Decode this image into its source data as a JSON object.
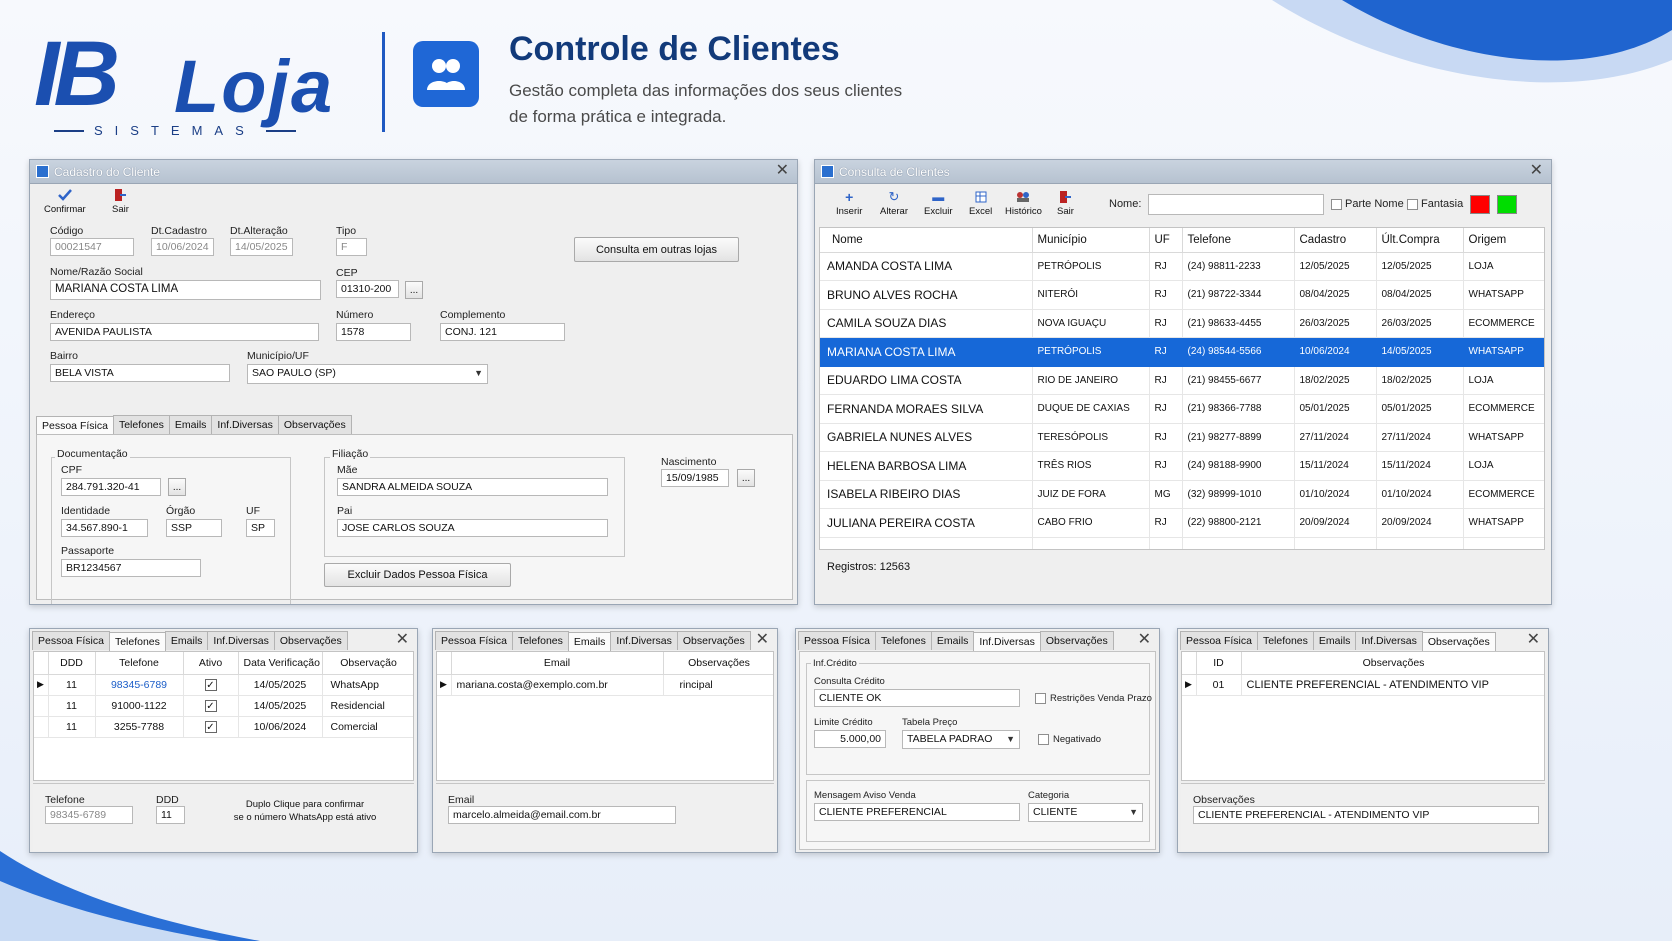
{
  "header": {
    "brand_ib": "IB",
    "brand_loja": "Loja",
    "brand_sistemas": "SISTEMAS",
    "title": "Controle de Clientes",
    "subtitle_line1": "Gestão completa das informações dos seus clientes",
    "subtitle_line2": "de forma prática e integrada."
  },
  "cadastro": {
    "title": "Cadastro do Cliente",
    "toolbar": {
      "confirmar": "Confirmar",
      "sair": "Sair"
    },
    "labels": {
      "codigo": "Código",
      "dt_cadastro": "Dt.Cadastro",
      "dt_alteracao": "Dt.Alteração",
      "tipo": "Tipo",
      "nome": "Nome/Razão Social",
      "cep": "CEP",
      "endereco": "Endereço",
      "numero": "Número",
      "complemento": "Complemento",
      "bairro": "Bairro",
      "municipio": "Município/UF"
    },
    "values": {
      "codigo": "00021547",
      "dt_cadastro": "10/06/2024",
      "dt_alteracao": "14/05/2025",
      "tipo": "F",
      "nome": "MARIANA COSTA LIMA",
      "cep": "01310-200",
      "endereco": "AVENIDA PAULISTA",
      "numero": "1578",
      "complemento": "CONJ. 121",
      "bairro": "BELA VISTA",
      "municipio": "SAO PAULO (SP)"
    },
    "btn_consulta_lojas": "Consulta em outras lojas",
    "ellipsis": "...",
    "tabs": [
      "Pessoa Física",
      "Telefones",
      "Emails",
      "Inf.Diversas",
      "Observações"
    ],
    "pf": {
      "documentacao": "Documentação",
      "cpf_label": "CPF",
      "cpf": "284.791.320-41",
      "identidade_label": "Identidade",
      "identidade": "34.567.890-1",
      "orgao_label": "Órgão",
      "orgao": "SSP",
      "uf_label": "UF",
      "uf": "SP",
      "passaporte_label": "Passaporte",
      "passaporte": "BR1234567",
      "filiacao": "Filiação",
      "mae_label": "Mãe",
      "mae": "SANDRA ALMEIDA SOUZA",
      "pai_label": "Pai",
      "pai": "JOSE CARLOS SOUZA",
      "nascimento_label": "Nascimento",
      "nascimento": "15/09/1985",
      "btn_excluir": "Excluir Dados Pessoa Física"
    }
  },
  "consulta": {
    "title": "Consulta de Clientes",
    "toolbar": [
      "Inserir",
      "Alterar",
      "Excluir",
      "Excel",
      "Histórico",
      "Sair"
    ],
    "nome_label": "Nome:",
    "nome_value": "",
    "parte_nome": "Parte Nome",
    "fantasia": "Fantasia",
    "colors": {
      "red": "#ff0000",
      "green": "#00dd00",
      "selection": "#1668d8"
    },
    "columns": [
      "Nome",
      "Município",
      "UF",
      "Telefone",
      "Cadastro",
      "Últ.Compra",
      "Origem"
    ],
    "rows": [
      [
        "AMANDA COSTA LIMA",
        "PETRÓPOLIS",
        "RJ",
        "(24) 98811-2233",
        "12/05/2025",
        "12/05/2025",
        "LOJA"
      ],
      [
        "BRUNO ALVES ROCHA",
        "NITERÓI",
        "RJ",
        "(21) 98722-3344",
        "08/04/2025",
        "08/04/2025",
        "WHATSAPP"
      ],
      [
        "CAMILA SOUZA DIAS",
        "NOVA IGUAÇU",
        "RJ",
        "(21) 98633-4455",
        "26/03/2025",
        "26/03/2025",
        "ECOMMERCE"
      ],
      [
        "MARIANA COSTA LIMA",
        "PETRÓPOLIS",
        "RJ",
        "(24) 98544-5566",
        "10/06/2024",
        "14/05/2025",
        "WHATSAPP"
      ],
      [
        "EDUARDO LIMA COSTA",
        "RIO DE JANEIRO",
        "RJ",
        "(21) 98455-6677",
        "18/02/2025",
        "18/02/2025",
        "LOJA"
      ],
      [
        "FERNANDA MORAES SILVA",
        "DUQUE DE CAXIAS",
        "RJ",
        "(21) 98366-7788",
        "05/01/2025",
        "05/01/2025",
        "ECOMMERCE"
      ],
      [
        "GABRIELA NUNES ALVES",
        "TERESÓPOLIS",
        "RJ",
        "(21) 98277-8899",
        "27/11/2024",
        "27/11/2024",
        "WHATSAPP"
      ],
      [
        "HELENA BARBOSA LIMA",
        "TRÊS RIOS",
        "RJ",
        "(24) 98188-9900",
        "15/11/2024",
        "15/11/2024",
        "LOJA"
      ],
      [
        "ISABELA RIBEIRO DIAS",
        "JUIZ DE FORA",
        "MG",
        "(32) 98999-1010",
        "01/10/2024",
        "01/10/2024",
        "ECOMMERCE"
      ],
      [
        "JULIANA PEREIRA COSTA",
        "CABO FRIO",
        "RJ",
        "(22) 98800-2121",
        "20/09/2024",
        "20/09/2024",
        "WHATSAPP"
      ]
    ],
    "selected_row": 3,
    "registros": "Registros: 12563"
  },
  "mini_tabs": [
    "Pessoa Física",
    "Telefones",
    "Emails",
    "Inf.Diversas",
    "Observações"
  ],
  "telefones": {
    "columns": [
      "DDD",
      "Telefone",
      "Ativo",
      "Data Verificação",
      "Observação"
    ],
    "rows": [
      [
        "11",
        "98345-6789",
        "✓",
        "14/05/2025",
        "WhatsApp"
      ],
      [
        "11",
        "91000-1122",
        "✓",
        "14/05/2025",
        "Residencial"
      ],
      [
        "11",
        "3255-7788",
        "✓",
        "10/06/2024",
        "Comercial"
      ]
    ],
    "telefone_label": "Telefone",
    "telefone": "98345-6789",
    "ddd_label": "DDD",
    "ddd": "11",
    "hint_line1": "Duplo Clique para confirmar",
    "hint_line2": "se o número WhatsApp está ativo"
  },
  "emails": {
    "columns": [
      "Email",
      "Observações"
    ],
    "rows": [
      [
        "mariana.costa@exemplo.com.br",
        "rincipal"
      ]
    ],
    "email_label": "Email",
    "email": "marcelo.almeida@email.com.br"
  },
  "infdiversas": {
    "inf_credito": "Inf.Crédito",
    "consulta_label": "Consulta Crédito",
    "consulta": "CLIENTE OK",
    "restricoes": "Restrições Venda Prazo",
    "limite_label": "Limite Crédito",
    "limite": "5.000,00",
    "tabela_label": "Tabela Preço",
    "tabela": "TABELA PADRAO",
    "negativado": "Negativado",
    "mensagem_label": "Mensagem Aviso Venda",
    "mensagem": "CLIENTE PREFERENCIAL",
    "categoria_label": "Categoria",
    "categoria": "CLIENTE"
  },
  "observacoes": {
    "columns": [
      "ID",
      "Observações"
    ],
    "rows": [
      [
        "01",
        "CLIENTE PREFERENCIAL - ATENDIMENTO VIP"
      ]
    ],
    "obs_label": "Observações",
    "obs": "CLIENTE PREFERENCIAL - ATENDIMENTO VIP"
  }
}
